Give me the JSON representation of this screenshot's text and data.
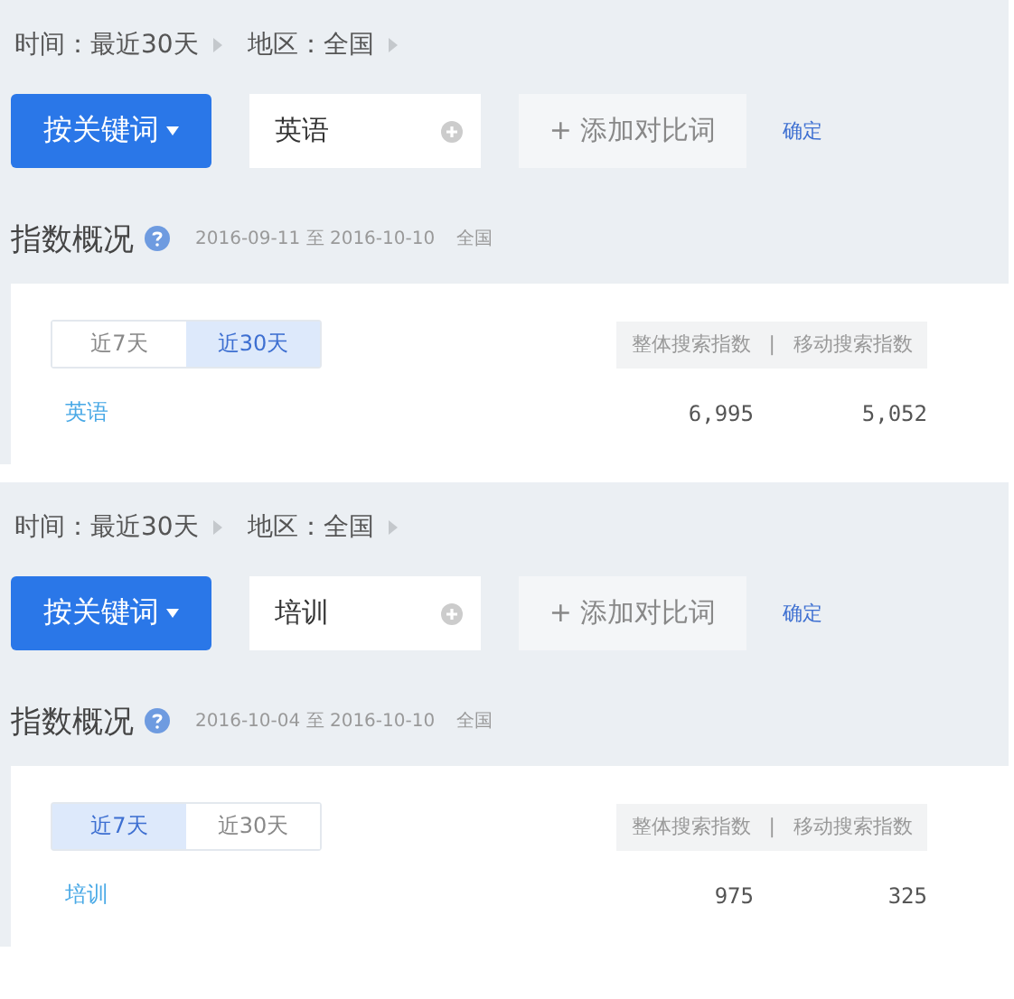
{
  "panels": [
    {
      "filters": [
        "时间：最近30天",
        "地区：全国"
      ],
      "mode_button": "按关键词",
      "keyword": "英语",
      "add_button": "+ 添加对比词",
      "confirm": "确定",
      "heading": "指数概况",
      "date_range": "2016-09-11 至 2016-10-10",
      "region": "全国",
      "tabs": [
        {
          "label": "近7天",
          "selected": false
        },
        {
          "label": "近30天",
          "selected": true
        }
      ],
      "metrics": [
        "整体搜索指数",
        "|",
        "移动搜索指数"
      ],
      "rows": [
        {
          "keyword": "英语",
          "overall": "6,995",
          "mobile": "5,052"
        }
      ]
    },
    {
      "filters": [
        "时间：最近30天",
        "地区：全国"
      ],
      "mode_button": "按关键词",
      "keyword": "培训",
      "add_button": "+ 添加对比词",
      "confirm": "确定",
      "heading": "指数概况",
      "date_range": "2016-10-04 至 2016-10-10",
      "region": "全国",
      "tabs": [
        {
          "label": "近7天",
          "selected": true
        },
        {
          "label": "近30天",
          "selected": false
        }
      ],
      "metrics": [
        "整体搜索指数",
        "|",
        "移动搜索指数"
      ],
      "rows": [
        {
          "keyword": "培训",
          "overall": "975",
          "mobile": "325"
        }
      ]
    }
  ]
}
